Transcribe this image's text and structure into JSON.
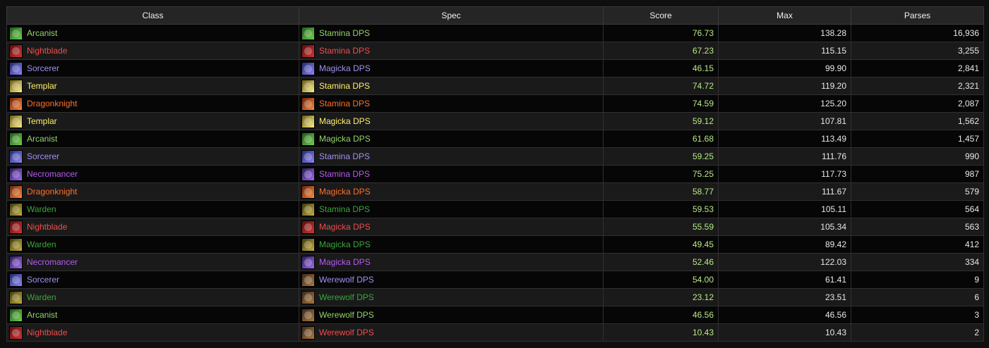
{
  "headers": {
    "class": "Class",
    "spec": "Spec",
    "score": "Score",
    "max": "Max",
    "parses": "Parses"
  },
  "colors": {
    "Arcanist": "#93d36a",
    "Nightblade": "#f04d4d",
    "Sorcerer": "#9d93f0",
    "Templar": "#fff06b",
    "Dragonknight": "#ff6f2b",
    "Necromancer": "#b45cf0",
    "Warden": "#3aa63a",
    "score": "#b8e986"
  },
  "rows": [
    {
      "cls": "Arcanist",
      "spec": "Stamina DPS",
      "score": "76.73",
      "max": "138.28",
      "parses": "16,936",
      "class_icon": "arcanist-icon",
      "spec_icon": "stamina-arcanist-icon"
    },
    {
      "cls": "Nightblade",
      "spec": "Stamina DPS",
      "score": "67.23",
      "max": "115.15",
      "parses": "3,255",
      "class_icon": "nightblade-icon",
      "spec_icon": "stamina-nightblade-icon"
    },
    {
      "cls": "Sorcerer",
      "spec": "Magicka DPS",
      "score": "46.15",
      "max": "99.90",
      "parses": "2,841",
      "class_icon": "sorcerer-icon",
      "spec_icon": "magicka-sorcerer-icon"
    },
    {
      "cls": "Templar",
      "spec": "Stamina DPS",
      "score": "74.72",
      "max": "119.20",
      "parses": "2,321",
      "class_icon": "templar-icon",
      "spec_icon": "stamina-templar-icon"
    },
    {
      "cls": "Dragonknight",
      "spec": "Stamina DPS",
      "score": "74.59",
      "max": "125.20",
      "parses": "2,087",
      "class_icon": "dragonknight-icon",
      "spec_icon": "stamina-dragonknight-icon"
    },
    {
      "cls": "Templar",
      "spec": "Magicka DPS",
      "score": "59.12",
      "max": "107.81",
      "parses": "1,562",
      "class_icon": "templar-icon",
      "spec_icon": "magicka-templar-icon"
    },
    {
      "cls": "Arcanist",
      "spec": "Magicka DPS",
      "score": "61.68",
      "max": "113.49",
      "parses": "1,457",
      "class_icon": "arcanist-icon",
      "spec_icon": "magicka-arcanist-icon"
    },
    {
      "cls": "Sorcerer",
      "spec": "Stamina DPS",
      "score": "59.25",
      "max": "111.76",
      "parses": "990",
      "class_icon": "sorcerer-icon",
      "spec_icon": "stamina-sorcerer-icon"
    },
    {
      "cls": "Necromancer",
      "spec": "Stamina DPS",
      "score": "75.25",
      "max": "117.73",
      "parses": "987",
      "class_icon": "necromancer-icon",
      "spec_icon": "stamina-necromancer-icon"
    },
    {
      "cls": "Dragonknight",
      "spec": "Magicka DPS",
      "score": "58.77",
      "max": "111.67",
      "parses": "579",
      "class_icon": "dragonknight-icon",
      "spec_icon": "magicka-dragonknight-icon"
    },
    {
      "cls": "Warden",
      "spec": "Stamina DPS",
      "score": "59.53",
      "max": "105.11",
      "parses": "564",
      "class_icon": "warden-icon",
      "spec_icon": "stamina-warden-icon"
    },
    {
      "cls": "Nightblade",
      "spec": "Magicka DPS",
      "score": "55.59",
      "max": "105.34",
      "parses": "563",
      "class_icon": "nightblade-icon",
      "spec_icon": "magicka-nightblade-icon"
    },
    {
      "cls": "Warden",
      "spec": "Magicka DPS",
      "score": "49.45",
      "max": "89.42",
      "parses": "412",
      "class_icon": "warden-icon",
      "spec_icon": "magicka-warden-icon"
    },
    {
      "cls": "Necromancer",
      "spec": "Magicka DPS",
      "score": "52.46",
      "max": "122.03",
      "parses": "334",
      "class_icon": "necromancer-icon",
      "spec_icon": "magicka-necromancer-icon"
    },
    {
      "cls": "Sorcerer",
      "spec": "Werewolf DPS",
      "score": "54.00",
      "max": "61.41",
      "parses": "9",
      "class_icon": "sorcerer-icon",
      "spec_icon": "werewolf-icon"
    },
    {
      "cls": "Warden",
      "spec": "Werewolf DPS",
      "score": "23.12",
      "max": "23.51",
      "parses": "6",
      "class_icon": "warden-icon",
      "spec_icon": "werewolf-icon"
    },
    {
      "cls": "Arcanist",
      "spec": "Werewolf DPS",
      "score": "46.56",
      "max": "46.56",
      "parses": "3",
      "class_icon": "arcanist-icon",
      "spec_icon": "werewolf-icon"
    },
    {
      "cls": "Nightblade",
      "spec": "Werewolf DPS",
      "score": "10.43",
      "max": "10.43",
      "parses": "2",
      "class_icon": "nightblade-icon",
      "spec_icon": "werewolf-icon"
    }
  ]
}
